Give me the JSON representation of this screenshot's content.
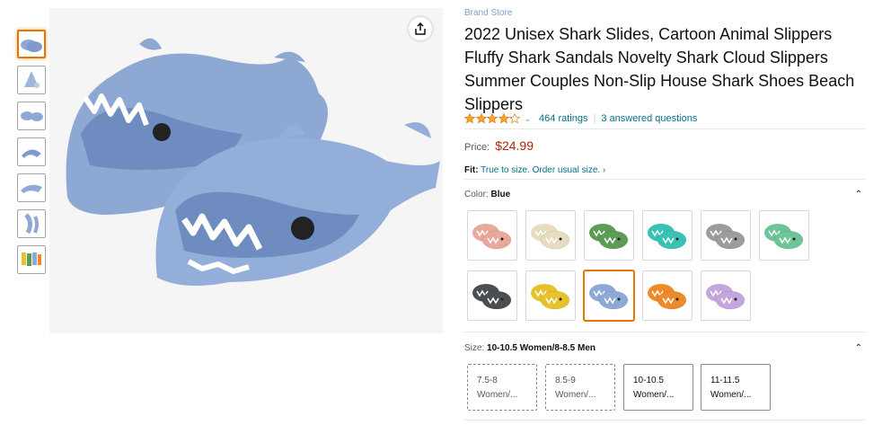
{
  "product": {
    "brand_link": "Brand Store",
    "title": "2022 Unisex Shark Slides, Cartoon Animal Slippers Fluffy Shark Sandals Novelty Shark Cloud Slippers Summer Couples Non-Slip House Shark Shoes Beach Slippers",
    "rating_stars": 4.2,
    "ratings_link": "464 ratings",
    "separator": "|",
    "questions_link": "3 answered questions",
    "price_label": "Price:",
    "price": "$24.99",
    "fit_label": "Fit:",
    "fit_link": "True to size. Order usual size. ›"
  },
  "colors": {
    "brand_star": "#ffa41c",
    "price": "#b12704",
    "link": "#007185",
    "shark_main": "#8fa9d6"
  },
  "icons": {
    "share": "share-icon",
    "caret": "chevron-up-icon",
    "rating_dropdown": "chevron-down-icon"
  },
  "color_section": {
    "label": "Color:",
    "selected": "Blue",
    "swatches": [
      {
        "color": "#e8a99a"
      },
      {
        "color": "#e8dcc0"
      },
      {
        "color": "#5d9c55"
      },
      {
        "color": "#38c2b6"
      },
      {
        "color": "#9a9c9e"
      },
      {
        "color": "#6ec59a"
      },
      {
        "color": "#4b4f52"
      },
      {
        "color": "#e6c22c"
      },
      {
        "color": "#8fa9d6"
      },
      {
        "color": "#ee8a2a"
      },
      {
        "color": "#c3a6de"
      }
    ]
  },
  "size_section": {
    "label": "Size:",
    "selected": "10-10.5 Women/8-8.5 Men",
    "options": [
      {
        "line1": "7.5-8",
        "line2": "Women/..."
      },
      {
        "line1": "8.5-9",
        "line2": "Women/..."
      },
      {
        "line1": "10-10.5",
        "line2": "Women/..."
      },
      {
        "line1": "11-11.5",
        "line2": "Women/..."
      }
    ]
  },
  "thumbnails": [
    {
      "label": "thumbnail-1"
    },
    {
      "label": "thumbnail-2"
    },
    {
      "label": "thumbnail-3"
    },
    {
      "label": "thumbnail-4"
    },
    {
      "label": "thumbnail-5"
    },
    {
      "label": "thumbnail-6"
    },
    {
      "label": "thumbnail-7"
    }
  ],
  "caret_glyph": "⌃",
  "chev_glyph": "⌄"
}
